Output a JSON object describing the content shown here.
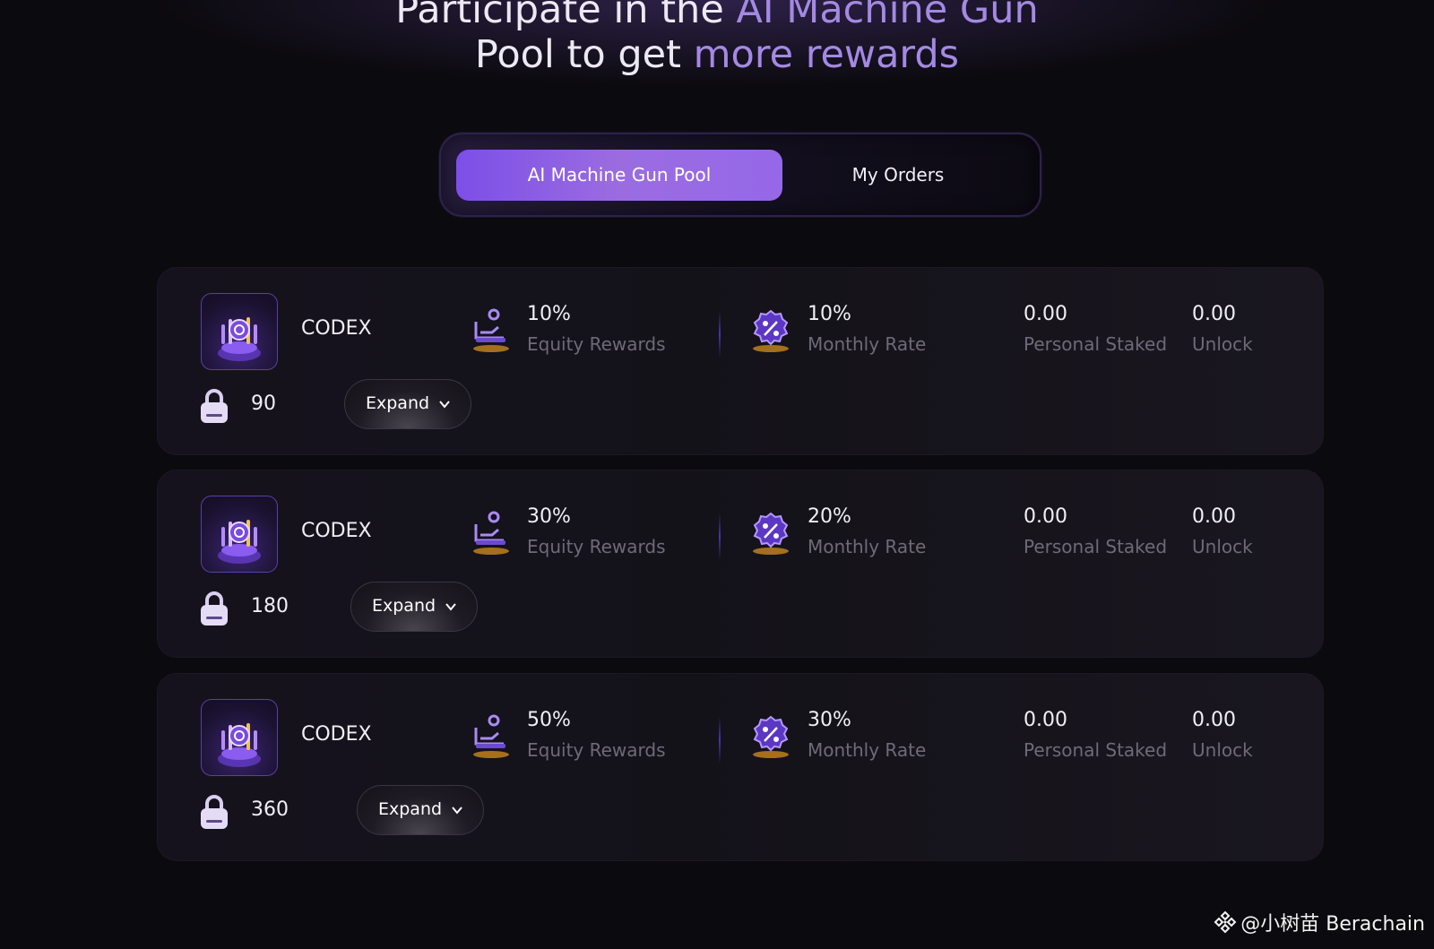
{
  "header": {
    "title_line1_plain": "Participate in the",
    "title_line1_accent": "AI Machine Gun",
    "title_line2_plain": "Pool to get",
    "title_line2_accent": "more rewards"
  },
  "tabs": {
    "active": "AI Machine Gun Pool",
    "inactive": "My Orders"
  },
  "pools": [
    {
      "name": "CODEX",
      "lock_days": "90",
      "expand_label": "Expand",
      "equity_value": "10%",
      "equity_label": "Equity Rewards",
      "monthly_value": "10%",
      "monthly_label": "Monthly Rate",
      "staked_value": "0.00",
      "staked_label": "Personal Staked",
      "unlock_value": "0.00",
      "unlock_label": "Unlock"
    },
    {
      "name": "CODEX",
      "lock_days": "180",
      "expand_label": "Expand",
      "equity_value": "30%",
      "equity_label": "Equity Rewards",
      "monthly_value": "20%",
      "monthly_label": "Monthly Rate",
      "staked_value": "0.00",
      "staked_label": "Personal Staked",
      "unlock_value": "0.00",
      "unlock_label": "Unlock"
    },
    {
      "name": "CODEX",
      "lock_days": "360",
      "expand_label": "Expand",
      "equity_value": "50%",
      "equity_label": "Equity Rewards",
      "monthly_value": "30%",
      "monthly_label": "Monthly Rate",
      "staked_value": "0.00",
      "staked_label": "Personal Staked",
      "unlock_value": "0.00",
      "unlock_label": "Unlock"
    }
  ],
  "icons": {
    "coin": "codex-coin-icon",
    "lock": "lock-icon",
    "equity": "equity-rewards-icon",
    "monthly": "percent-badge-icon",
    "expand": "chevron-down-icon"
  },
  "colors": {
    "accent_purple": "#a489e3",
    "tab_active_gradient_start": "#7c4fe8",
    "tab_active_gradient_end": "#9568e9",
    "background": "#0b0a0e",
    "muted_label": "#6e6a78"
  },
  "watermark": {
    "text": "@小树苗 Berachain"
  }
}
